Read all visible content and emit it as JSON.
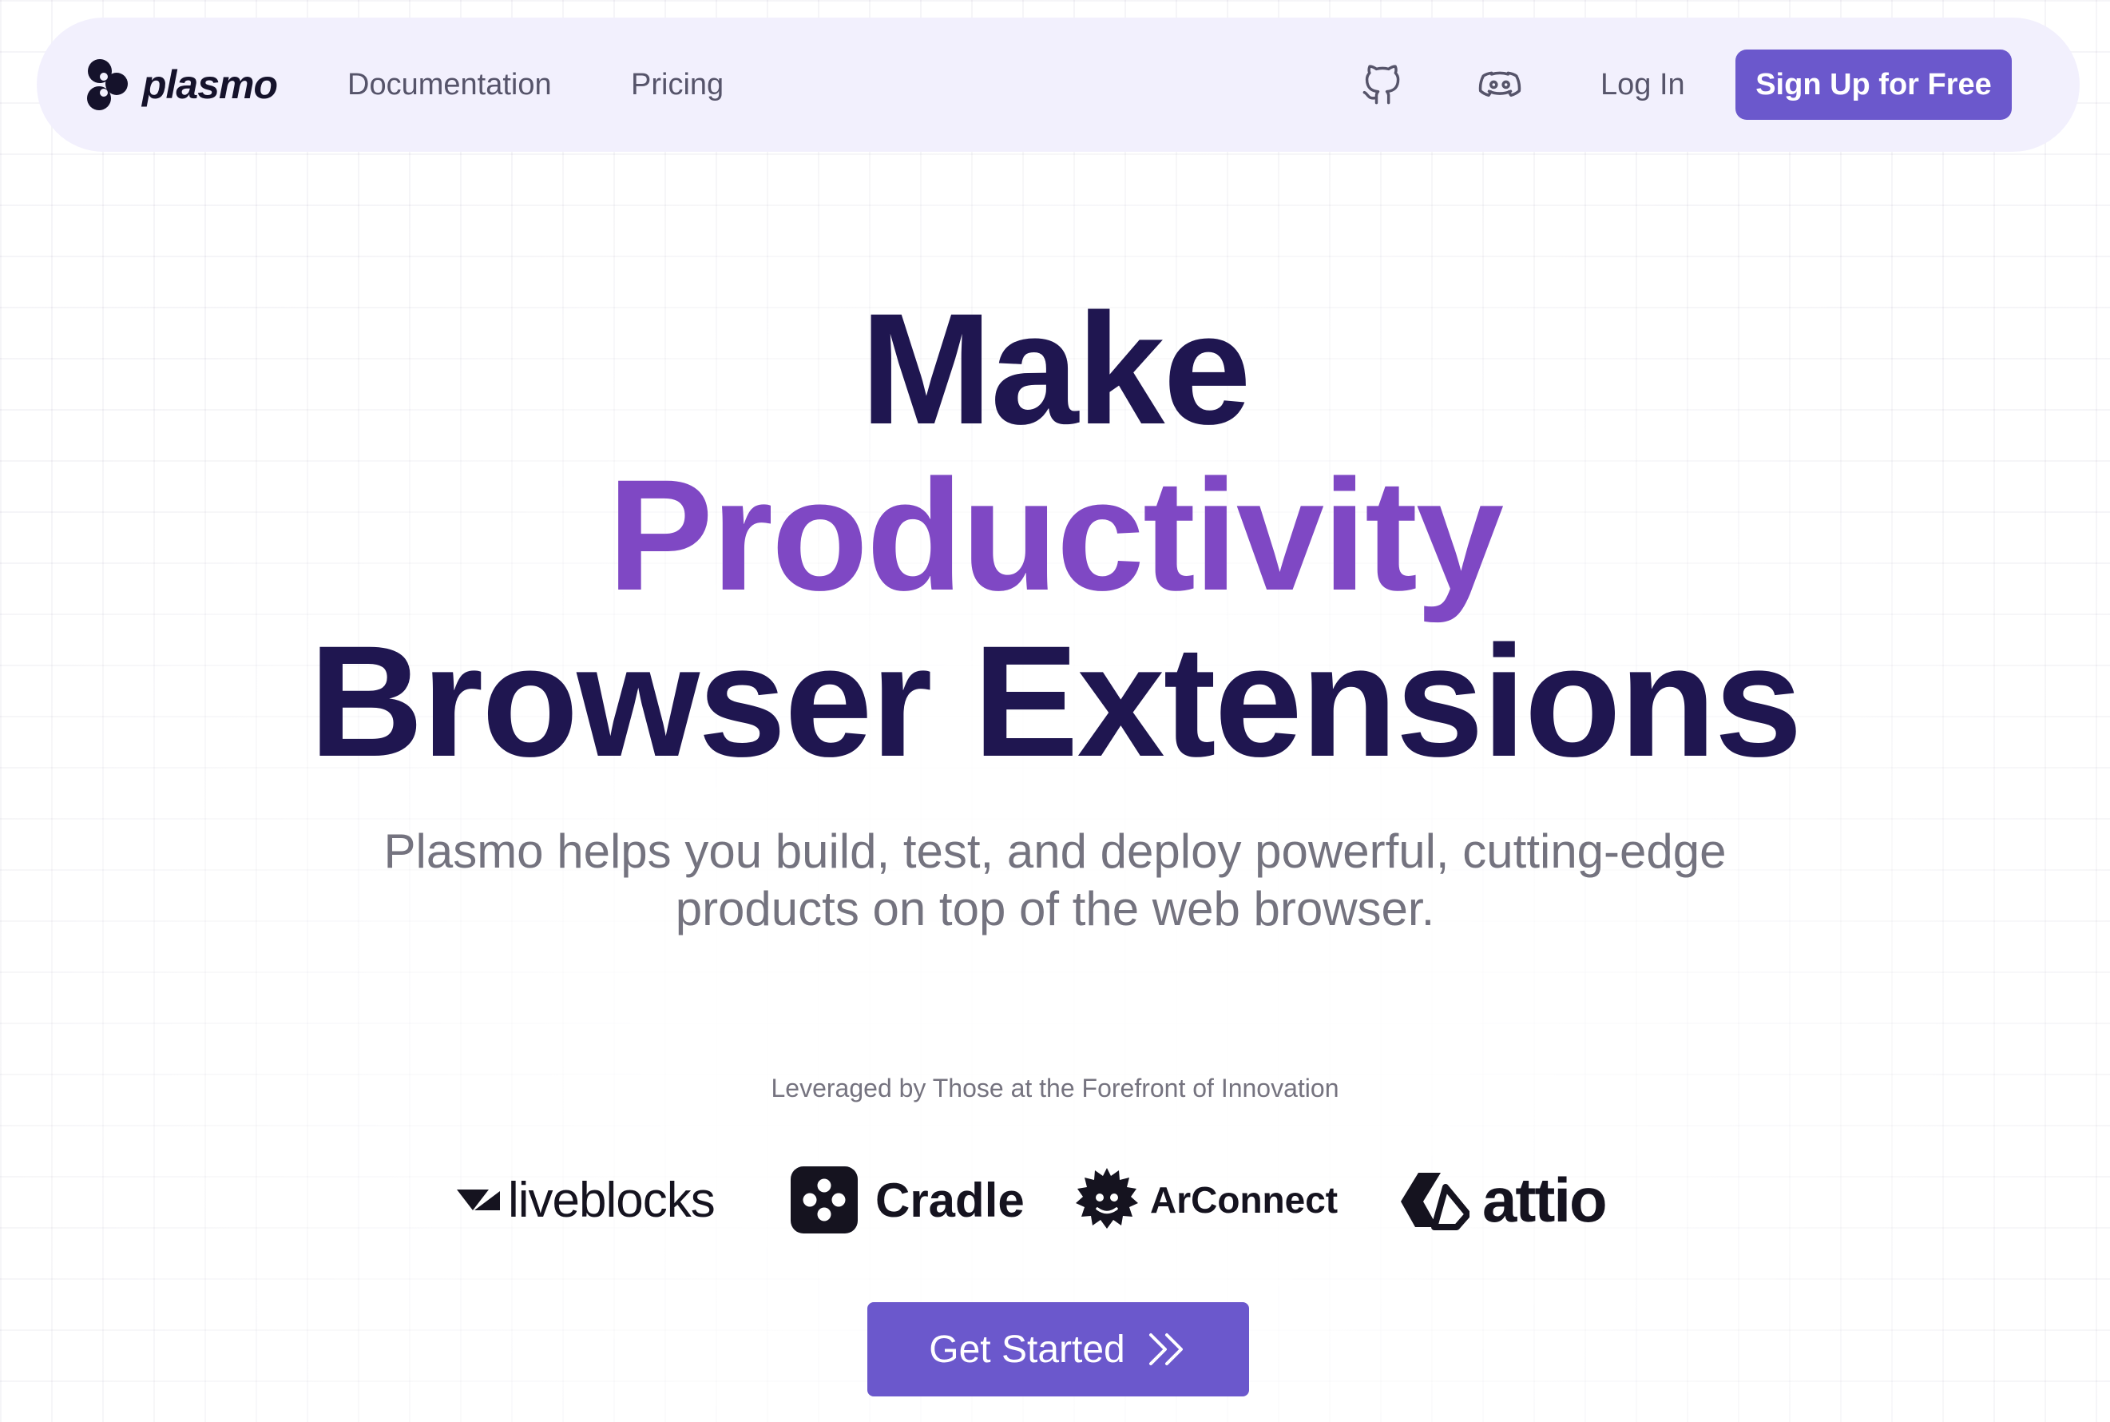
{
  "nav": {
    "logo_text": "plasmo",
    "links": [
      {
        "label": "Documentation"
      },
      {
        "label": "Pricing"
      }
    ],
    "github_icon": "github-icon",
    "discord_icon": "discord-icon",
    "login_label": "Log In",
    "signup_label": "Sign Up for Free"
  },
  "hero": {
    "line1": "Make",
    "line2": "Productivity",
    "line3": "Browser Extensions",
    "subtitle": "Plasmo helps you build, test, and deploy powerful, cutting-edge products on top of the web browser."
  },
  "customers": {
    "heading": "Leveraged by Those at the Forefront of Innovation",
    "logos": [
      {
        "name": "liveblocks"
      },
      {
        "name": "Cradle"
      },
      {
        "name": "ArConnect"
      },
      {
        "name": "attio"
      }
    ]
  },
  "cta": {
    "label": "Get Started",
    "icon": "double-chevron-right-icon"
  },
  "colors": {
    "accent": "#6b58cc",
    "headline": "#1f1650",
    "headline_accent": "#7f48c4",
    "navbar_bg": "#f2f0fd",
    "muted_text": "#74737f"
  }
}
